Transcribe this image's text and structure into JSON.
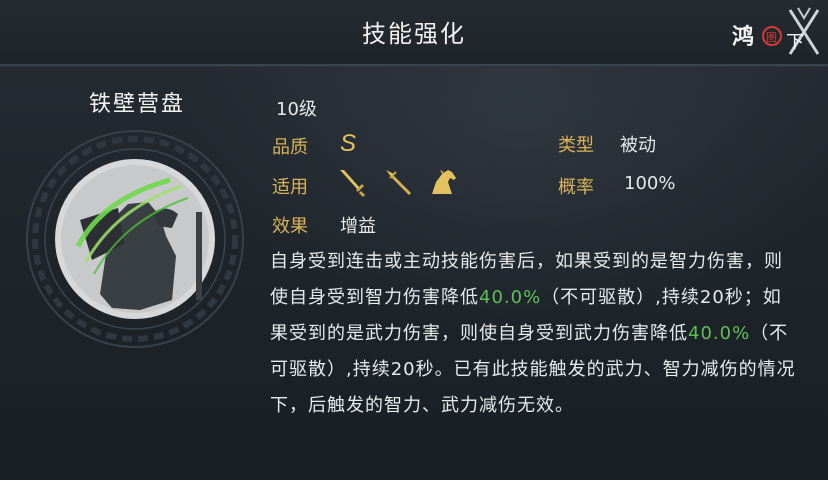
{
  "header": {
    "title": "技能强化",
    "logo_text": "鸿图之下"
  },
  "skill": {
    "name": "铁壁营盘",
    "level": "10级",
    "quality_label": "品质",
    "quality_value": "S",
    "type_label": "类型",
    "type_value": "被动",
    "apply_label": "适用",
    "apply_icons": [
      "sword-icon",
      "spear-icon",
      "horse-icon"
    ],
    "rate_label": "概率",
    "rate_value": "100%",
    "effect_label": "效果",
    "effect_value": "增益",
    "description": {
      "p1": "自身受到连击或主动技能伤害后，如果受到的是智力伤害，则使自身受到智力伤害降低",
      "v1": "40.0%",
      "p2": "（不可驱散）,持续20秒；如果受到的是武力伤害，则使自身受到武力伤害降低",
      "v2": "40.0%",
      "p3": "（不可驱散）,持续20秒。已有此技能触发的武力、智力减伤的情况下，后触发的智力、武力减伤无效。"
    }
  },
  "colors": {
    "label_gold": "#d9b35a",
    "highlight_green": "#5fbf57",
    "text": "#e8eaec"
  }
}
